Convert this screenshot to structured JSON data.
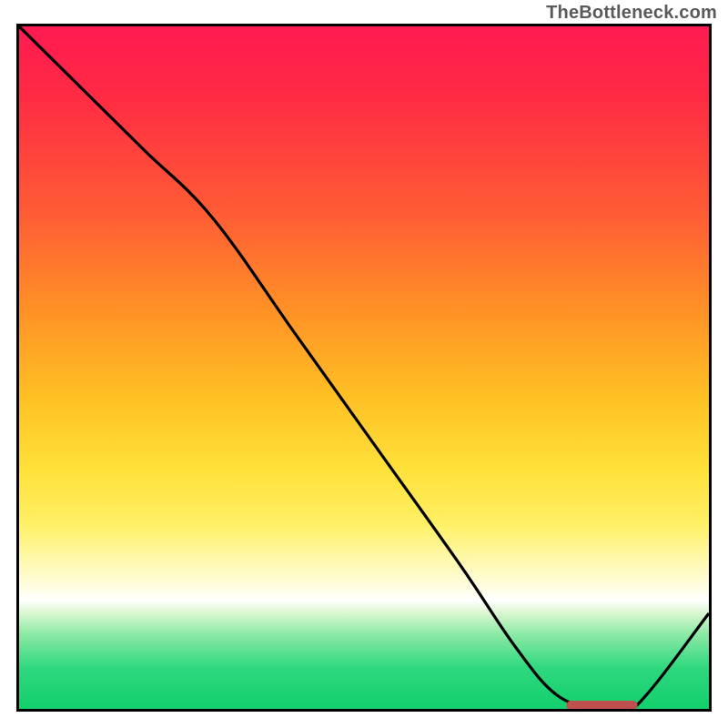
{
  "attribution": "TheBottleneck.com",
  "chart_data": {
    "type": "line",
    "title": "",
    "xlabel": "",
    "ylabel": "",
    "xlim": [
      0,
      100
    ],
    "ylim": [
      0,
      100
    ],
    "series": [
      {
        "name": "curve",
        "x": [
          0,
          8,
          18,
          28,
          40,
          52,
          64,
          72,
          78,
          84,
          89,
          100
        ],
        "y": [
          100,
          92,
          82,
          72,
          55,
          38,
          21,
          9,
          2,
          0,
          0,
          14
        ]
      }
    ],
    "marker": {
      "name": "highlight-segment",
      "x_start": 80,
      "x_end": 89,
      "y": 0
    },
    "colors": {
      "curve": "#000000",
      "marker": "#c05050",
      "gradient_top": "#ff1a51",
      "gradient_mid": "#ffe13a",
      "gradient_bottom": "#12cf6c"
    }
  }
}
